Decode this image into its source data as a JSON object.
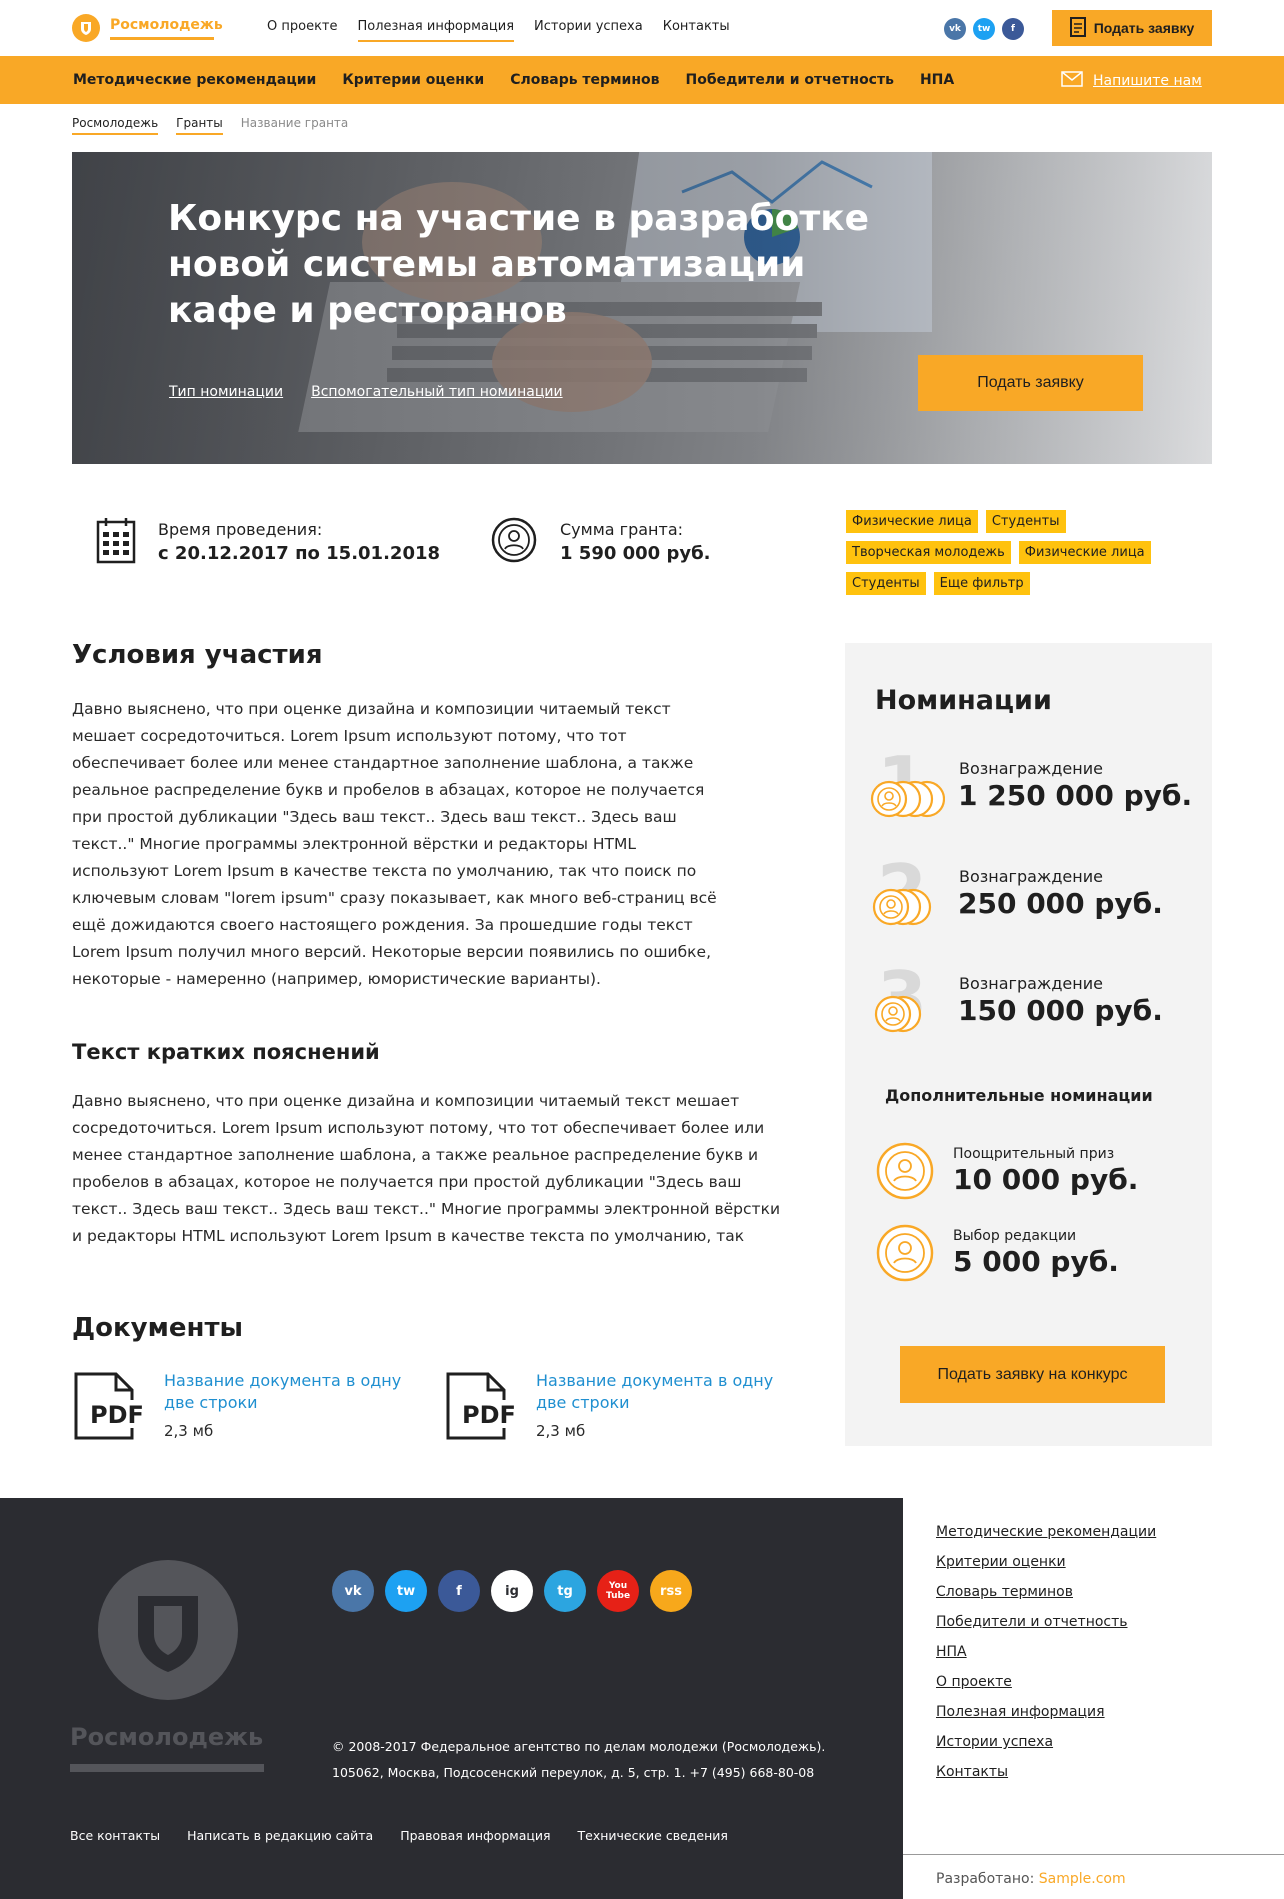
{
  "header": {
    "logo_text": "Росмолодежь",
    "nav": [
      "О проекте",
      "Полезная информация",
      "Истории успеха",
      "Контакты"
    ],
    "social": [
      {
        "label": "vk",
        "color": "#4a76a8"
      },
      {
        "label": "tw",
        "color": "#1da1f2"
      },
      {
        "label": "f",
        "color": "#3b5998"
      }
    ],
    "apply_button": "Подать заявку"
  },
  "orange_nav": {
    "items": [
      "Методические рекомендации",
      "Критерии оценки",
      "Словарь терминов",
      "Победители и отчетность",
      "НПА"
    ],
    "write_us": "Напишите нам"
  },
  "breadcrumb": {
    "items": [
      "Росмолодежь",
      "Гранты"
    ],
    "current": "Название гранта"
  },
  "hero": {
    "title": "Конкурс на участие в разработке новой системы автоматизации кафе и ресторанов",
    "link1": "Тип номинации",
    "link2": "Вспомогательный тип номинации",
    "button": "Подать заявку"
  },
  "info": {
    "time_label": "Время проведения:",
    "time_value": "с 20.12.2017 по 15.01.2018",
    "sum_label": "Сумма гранта:",
    "sum_value": "1 590 000 руб."
  },
  "tags": [
    "Физические лица",
    "Студенты",
    "Творческая молодежь",
    "Физические лица",
    "Студенты",
    "Еще фильтр"
  ],
  "conditions": {
    "title": "Условия участия",
    "text": "Давно выяснено, что при оценке дизайна и композиции читаемый текст мешает сосредоточиться. Lorem Ipsum используют потому, что тот обеспечивает более или менее стандартное заполнение шаблона, а также реальное распределение букв и пробелов в абзацах, которое не получается при простой дубликации \"Здесь ваш текст.. Здесь ваш текст.. Здесь ваш текст..\" Многие программы электронной вёрстки и редакторы HTML используют Lorem Ipsum в качестве текста по умолчанию, так что поиск по ключевым словам \"lorem ipsum\" сразу показывает, как много веб-страниц всё ещё дожидаются своего настоящего рождения. За прошедшие годы текст Lorem Ipsum получил много версий. Некоторые версии появились по ошибке, некоторые - намеренно (например, юмористические варианты)."
  },
  "explanations": {
    "title": "Текст кратких пояснений",
    "text": "Давно выяснено, что при оценке дизайна и композиции читаемый текст мешает сосредоточиться. Lorem Ipsum используют потому, что тот обеспечивает более или менее стандартное заполнение шаблона, а также реальное распределение букв и пробелов в абзацах, которое не получается при простой дубликации \"Здесь ваш текст.. Здесь ваш текст.. Здесь ваш текст..\" Многие программы электронной вёрстки и редакторы HTML используют Lorem Ipsum в качестве текста по умолчанию, так"
  },
  "documents": {
    "title": "Документы",
    "items": [
      {
        "name": "Название документа в одну две строки",
        "size": "2,3 мб",
        "type": "PDF"
      },
      {
        "name": "Название документа в одну две строки",
        "size": "2,3 мб",
        "type": "PDF"
      }
    ]
  },
  "nominations": {
    "title": "Номинации",
    "items": [
      {
        "rank": "1",
        "label": "Вознаграждение",
        "amount": "1 250 000 руб."
      },
      {
        "rank": "2",
        "label": "Вознаграждение",
        "amount": "250 000 руб."
      },
      {
        "rank": "3",
        "label": "Вознаграждение",
        "amount": "150 000 руб."
      }
    ],
    "extra_title": "Дополнительные номинации",
    "extra": [
      {
        "label": "Поощрительный приз",
        "amount": "10 000 руб."
      },
      {
        "label": "Выбор редакции",
        "amount": "5 000 руб."
      }
    ],
    "button": "Подать заявку на конкурс"
  },
  "footer": {
    "logo_text": "Росмолодежь",
    "social": [
      {
        "label": "vk",
        "color": "#4a76a8"
      },
      {
        "label": "tw",
        "color": "#1da1f2"
      },
      {
        "label": "f",
        "color": "#3b5998"
      },
      {
        "label": "ig",
        "color": "#ffffff"
      },
      {
        "label": "tg",
        "color": "#2ca5e0"
      },
      {
        "label": "You Tube",
        "color": "#e62117"
      },
      {
        "label": "rss",
        "color": "#f7a81b"
      }
    ],
    "copyright": "© 2008-2017 Федеральное агентство по делам молодежи (Росмолодежь).",
    "address": "105062, Москва, Подсосенский переулок, д. 5, стр. 1.  +7 (495) 668-80-08",
    "links": [
      "Все контакты",
      "Написать в редакцию сайта",
      "Правовая информация",
      "Технические сведения"
    ],
    "menu": [
      "Методические рекомендации",
      "Критерии оценки",
      "Словарь терминов",
      "Победители и отчетность",
      "НПА",
      "О проекте",
      "Полезная информация",
      "Истории успеха",
      "Контакты"
    ],
    "developed_label": "Разработано:",
    "developed_link": "Sample.com"
  },
  "colors": {
    "accent": "#f9a826",
    "tag": "#ffc20e",
    "footer_bg": "#2b2c31",
    "link": "#1f8fd0"
  }
}
